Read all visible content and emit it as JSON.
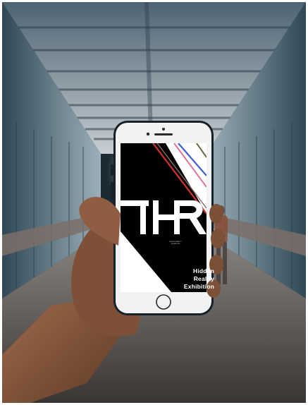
{
  "poster": {
    "logo_letters": "THR",
    "title_lines": [
      "Hidden",
      "Reality",
      "Exhibition"
    ]
  },
  "colors": {
    "ceiling": "#566a78",
    "wall": "#3f5a68",
    "floor": "#4a4645",
    "phone_body": "#17212a",
    "phone_face": "#f2f2f2",
    "skin": "#8a5b3f",
    "poster_black": "#000000",
    "poster_white": "#ffffff",
    "stripe_red": "#d2322e",
    "stripe_blue": "#3b5fd1",
    "stripe_pink": "#e0719a",
    "stripe_olive": "#6b6a38"
  },
  "icons": [
    "hand",
    "smartphone",
    "home-button-icon"
  ]
}
